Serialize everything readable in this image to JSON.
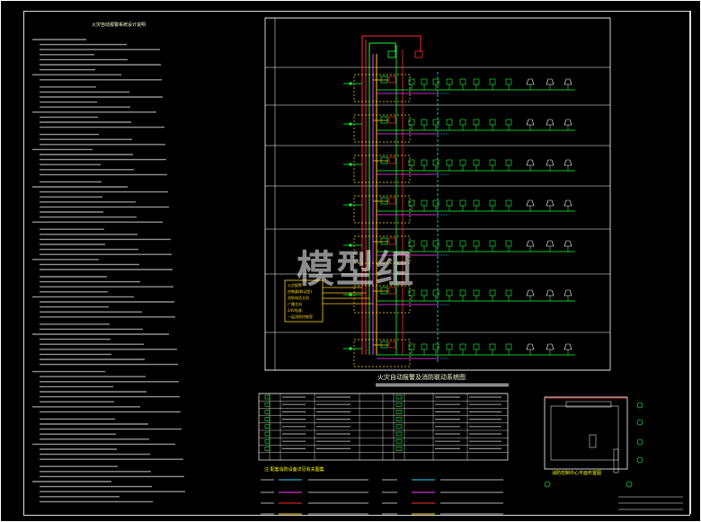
{
  "drawing": {
    "notes_title": "火灾自动报警系统设计说明",
    "main_diagram_title": "火灾自动报警及消防联动系统图",
    "legend_title": "注:配套消防设备详见有关图集",
    "sub_plan_title": "消防控制中心平面布置图",
    "watermark": "模型组",
    "control_box_lines": [
      "火灾报警",
      "控制器(联动型)",
      "消防电话主机",
      "广播主机",
      "24V电源",
      "一层消防控制室"
    ],
    "floor_count": 7,
    "colors": {
      "background": "#000000",
      "red": "#ff2a2a",
      "green": "#19ff3a",
      "yellow": "#ffd21a",
      "magenta": "#ff3cff",
      "cyan": "#22d8ff",
      "white": "#ffffff"
    }
  }
}
